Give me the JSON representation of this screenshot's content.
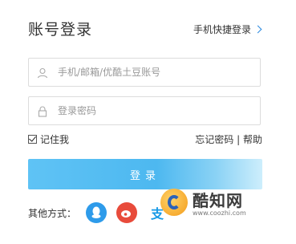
{
  "header": {
    "title": "账号登录",
    "quick_login": "手机快捷登录"
  },
  "form": {
    "account_placeholder": "手机/邮箱/优酷土豆账号",
    "password_placeholder": "登录密码",
    "remember_label": "记住我",
    "remember_checked": true,
    "forgot_label": "忘记密码",
    "separator": "|",
    "help_label": "帮助",
    "login_label": "登录"
  },
  "social": {
    "label": "其他方式：",
    "icons": [
      "qq-icon",
      "weibo-icon",
      "alipay-icon"
    ]
  },
  "watermark": {
    "name": "酷知网",
    "url": "www.coozhi.com"
  },
  "colors": {
    "accent": "#4db8f0",
    "link": "#2a8ae0"
  }
}
